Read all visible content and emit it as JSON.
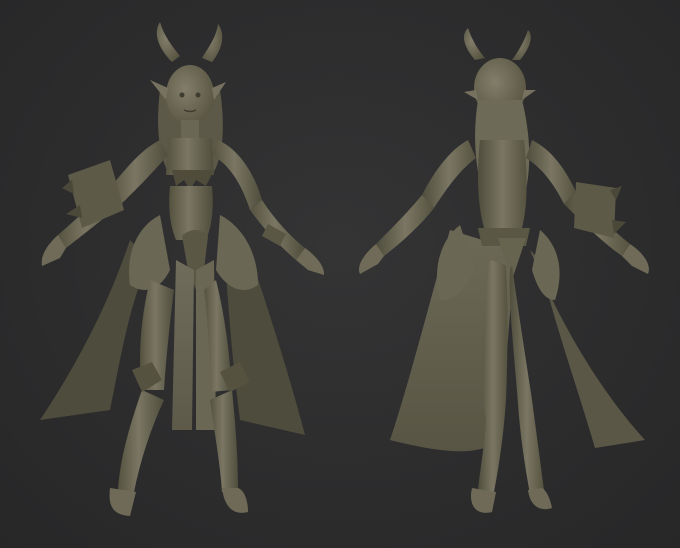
{
  "scene": {
    "background_color": "#2b2b2c",
    "clay_color": "#6e6b5a",
    "clay_shadow": "#4a4839",
    "clay_highlight": "#8c8874"
  },
  "views": [
    {
      "id": "front",
      "description_icon": "character-front-sculpt"
    },
    {
      "id": "back",
      "description_icon": "character-back-sculpt"
    }
  ]
}
